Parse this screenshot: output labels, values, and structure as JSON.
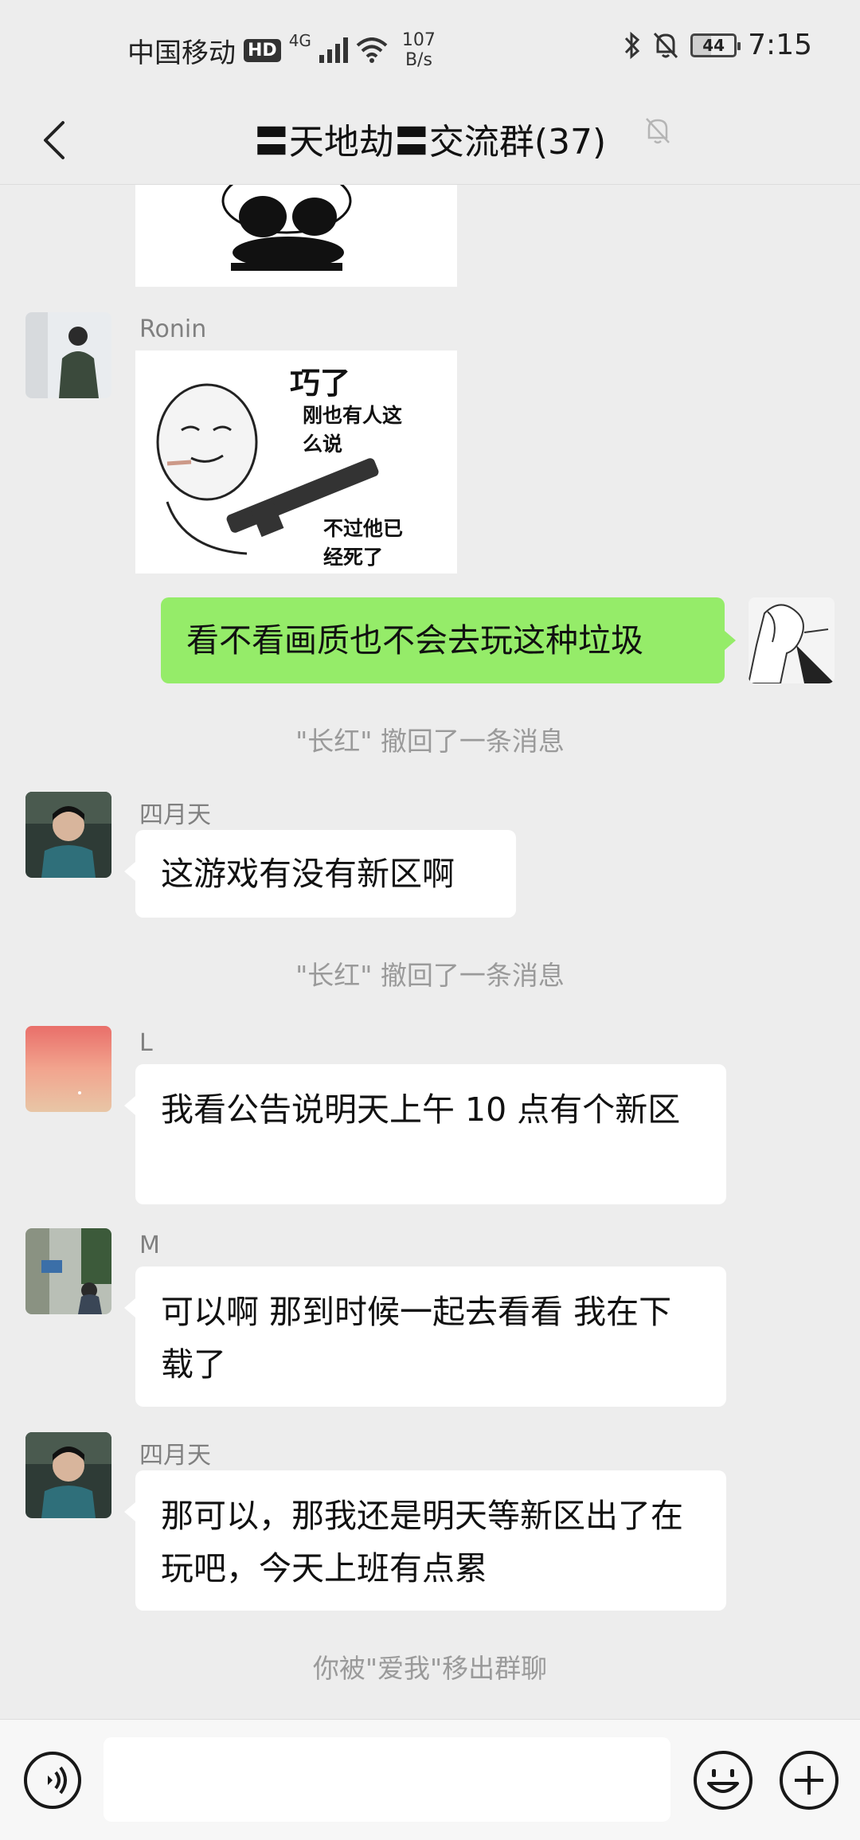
{
  "status_bar": {
    "carrier": "中国移动",
    "hd": "HD",
    "network": "4G",
    "speed_value": "107",
    "speed_unit": "B/s",
    "battery": "44",
    "time": "7:15"
  },
  "header": {
    "title": "〓天地劫〓交流群(37)"
  },
  "messages": [
    {
      "type": "sticker",
      "sender": "",
      "side": "left",
      "icon": "panda-sticker"
    },
    {
      "type": "sticker",
      "sender": "Ronin",
      "side": "left",
      "icon": "meme-sticker",
      "sticker_text": {
        "big": "巧了",
        "line1": "刚也有人这",
        "line2": "么说",
        "line3": "不过他已",
        "line4": "经死了"
      }
    },
    {
      "type": "text",
      "sender": "me",
      "side": "right",
      "text": "看不看画质也不会去玩这种垃圾"
    },
    {
      "type": "system",
      "text": "\"长红\" 撤回了一条消息"
    },
    {
      "type": "text",
      "sender": "四月天",
      "side": "left",
      "text": "这游戏有没有新区啊"
    },
    {
      "type": "system",
      "text": "\"长红\" 撤回了一条消息"
    },
    {
      "type": "text",
      "sender": "L",
      "side": "left",
      "text": "我看公告说明天上午 10 点有个新区"
    },
    {
      "type": "text",
      "sender": "M",
      "side": "left",
      "text": "可以啊 那到时候一起去看看 我在下载了"
    },
    {
      "type": "text",
      "sender": "四月天",
      "side": "left",
      "text": "那可以，那我还是明天等新区出了在玩吧，今天上班有点累"
    },
    {
      "type": "system",
      "text": "你被\"爱我\"移出群聊"
    }
  ],
  "input": {
    "placeholder": "",
    "value": ""
  },
  "colors": {
    "background": "#ededed",
    "my_bubble": "#95ec69",
    "other_bubble": "#ffffff",
    "system_text": "#9a9a9a"
  }
}
